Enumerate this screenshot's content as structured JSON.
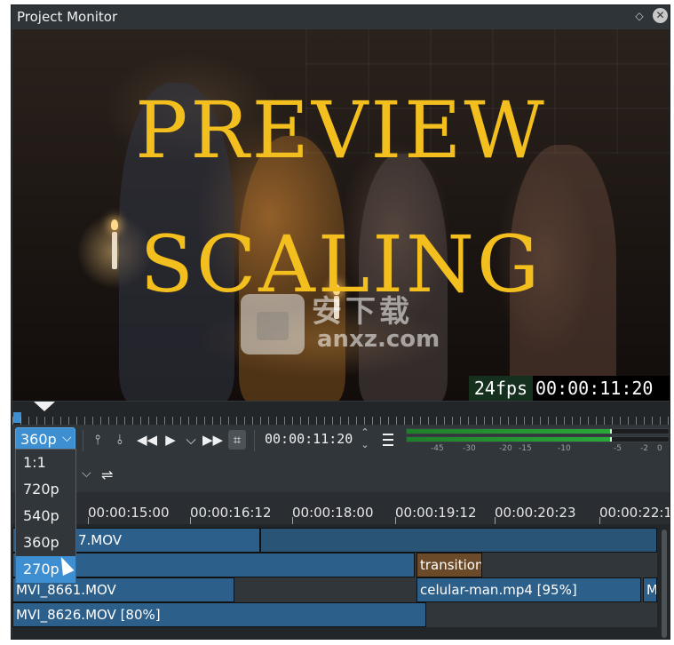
{
  "window": {
    "title": "Project Monitor"
  },
  "video": {
    "overlay_line1": "PREVIEW",
    "overlay_line2": "SCALING",
    "fps": "24fps",
    "timecode": "00:00:11:20",
    "watermark_cn": "安下载",
    "watermark_url": "anxz.com"
  },
  "controls": {
    "scale_value": "360p",
    "timecode": "00:00:11:20",
    "vu_ticks": [
      "-45",
      "-30",
      "-20",
      "-15",
      "-10",
      "-5",
      "-2",
      "0"
    ],
    "vu_level_top": 0.78,
    "vu_level_bottom": 0.78
  },
  "scale_dropdown": {
    "options": [
      "1:1",
      "720p",
      "540p",
      "360p",
      "270p"
    ],
    "selected": "270p"
  },
  "timeline": {
    "times": [
      "00:00:15:00",
      "00:00:16:12",
      "00:00:18:00",
      "00:00:19:12",
      "00:00:20:23",
      "00:00:22:1"
    ],
    "clips": {
      "v1_clip1": "7.MOV",
      "v2_transition": "transition",
      "a1_clip1": "MVI_8661.MOV",
      "a1_clip2": "celular-man.mp4 [95%]",
      "a1_clip3": "M",
      "a2_clip1": "MVI_8626.MOV [80%]"
    }
  },
  "colors": {
    "accent": "#3d8fd1",
    "overlay_text": "#f3bf1e",
    "clip": "#2c5f8a",
    "transition": "#6b4a2a"
  }
}
